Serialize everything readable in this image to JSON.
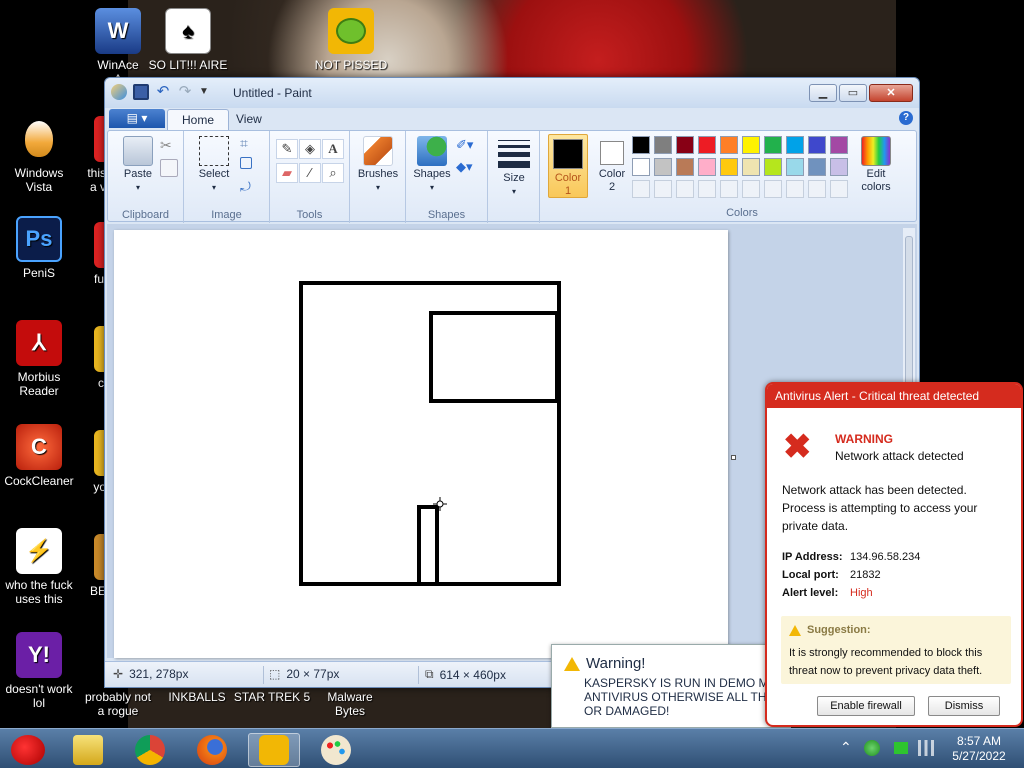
{
  "desktop": {
    "icons": [
      {
        "label": "WinAce\nA",
        "icon": "winace-icon"
      },
      {
        "label": "SO LIT!!! AIRE",
        "icon": "playing-card-icon"
      },
      {
        "label": "NOT PISSED",
        "icon": "green-pig-icon"
      },
      {
        "label": "Windows\nVista",
        "icon": "egg-icon"
      },
      {
        "label": "this\na v",
        "icon": "red-circle-icon"
      },
      {
        "label": "PeniS",
        "icon": "photoshop-icon"
      },
      {
        "label": "fu",
        "icon": "red-circle-icon"
      },
      {
        "label": "Morbius\nReader",
        "icon": "pdf-icon"
      },
      {
        "label": "c",
        "icon": "yellow-circle-icon"
      },
      {
        "label": "CockCleaner",
        "icon": "cleaner-icon"
      },
      {
        "label": "yo",
        "icon": "yellow-circle-icon"
      },
      {
        "label": "who the fuck\nuses this",
        "icon": "lightning-icon"
      },
      {
        "label": "BE",
        "icon": "partial-icon"
      },
      {
        "label": "doesn't work\nlol",
        "icon": "yahoo-icon"
      },
      {
        "label": "probably not\na rogue",
        "icon": "partial-icon"
      },
      {
        "label": "INKBALLS",
        "icon": "partial-icon"
      },
      {
        "label": "STAR TREK 5",
        "icon": "partial-icon"
      },
      {
        "label": "Malware\nBytes",
        "icon": "partial-icon"
      }
    ]
  },
  "paint": {
    "title": "Untitled - Paint",
    "tabs": {
      "file": "",
      "home": "Home",
      "view": "View"
    },
    "groups": {
      "clipboard": "Clipboard",
      "image": "Image",
      "tools": "Tools",
      "shapes": "Shapes",
      "colors": "Colors"
    },
    "buttons": {
      "paste": "Paste",
      "select": "Select",
      "brushes": "Brushes",
      "shapes": "Shapes",
      "size": "Size",
      "color1": "Color\n1",
      "color2": "Color\n2",
      "edit_colors": "Edit\ncolors"
    },
    "colors": {
      "color1": "#000000",
      "color2": "#ffffff",
      "palette": [
        "#000000",
        "#7f7f7f",
        "#880015",
        "#ed1c24",
        "#ff7f27",
        "#fff200",
        "#22b14c",
        "#00a2e8",
        "#3f48cc",
        "#a349a4",
        "#ffffff",
        "#c3c3c3",
        "#b97a57",
        "#ffaec9",
        "#ffc90e",
        "#efe4b0",
        "#b5e61d",
        "#99d9ea",
        "#7092be",
        "#c8bfe7"
      ]
    },
    "status": {
      "cursor": "321, 278px",
      "selection": "20 × 77px",
      "image_size": "614 × 460px"
    }
  },
  "kaspersky": {
    "title": "Warning!",
    "body": "KASPERSKY IS RUN IN DEMO MOD\nANTIVIRUS OTHERWISE ALL THE D\nOR DAMAGED!"
  },
  "antivirus": {
    "header": "Antivirus Alert - Critical threat detected",
    "warning": "WARNING",
    "subtitle": "Network attack detected",
    "message": "Network attack has been detected. Process is attempting to access your private data.",
    "ip_label": "IP Address:",
    "ip_value": "134.96.58.234",
    "port_label": "Local port:",
    "port_value": "21832",
    "level_label": "Alert level:",
    "level_value": "High",
    "suggestion_title": "Suggestion:",
    "suggestion_body": "It is strongly recommended to block this threat now to prevent privacy data theft.",
    "enable_button": "Enable firewall",
    "dismiss_button": "Dismiss"
  },
  "taskbar": {
    "time": "8:57 AM",
    "date": "5/27/2022"
  }
}
